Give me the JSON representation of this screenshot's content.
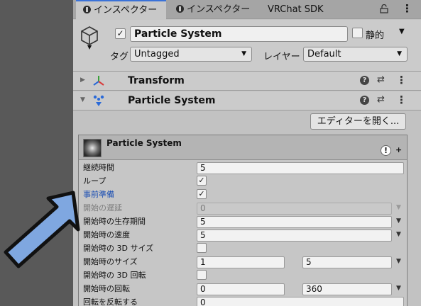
{
  "tabs": [
    {
      "label": "インスペクター",
      "active": true
    },
    {
      "label": "インスペクター",
      "active": false
    },
    {
      "label": "VRChat SDK",
      "active": false
    }
  ],
  "object": {
    "active_check": "✓",
    "name": "Particle System",
    "static_label": "静的",
    "tag_label": "タグ",
    "tag_value": "Untagged",
    "layer_label": "レイヤー",
    "layer_value": "Default"
  },
  "components": [
    {
      "title": "Transform",
      "expanded": false
    },
    {
      "title": "Particle System",
      "expanded": true
    }
  ],
  "editor_button": "エディターを開く...",
  "module": {
    "title": "Particle System",
    "properties": [
      {
        "label": "継続時間",
        "value": "5"
      },
      {
        "label": "ループ",
        "checked": true
      },
      {
        "label": "事前準備",
        "checked": true
      },
      {
        "label": "開始の遅延",
        "value": "0"
      },
      {
        "label": "開始時の生存期間",
        "value": "5"
      },
      {
        "label": "開始時の速度",
        "value": "5"
      },
      {
        "label": "開始時の 3D サイズ",
        "checked": false
      },
      {
        "label": "開始時のサイズ",
        "value": "1",
        "value2": "5"
      },
      {
        "label": "開始時の 3D 回転",
        "checked": false
      },
      {
        "label": "開始時の回転",
        "value": "0",
        "value2": "360"
      },
      {
        "label": "回転を反転する",
        "value": "0"
      }
    ]
  },
  "colors": {
    "accent_tab": "#3a72d8",
    "highlight_label": "#1c4fb3",
    "arrow_fill": "#7fa7e0"
  }
}
